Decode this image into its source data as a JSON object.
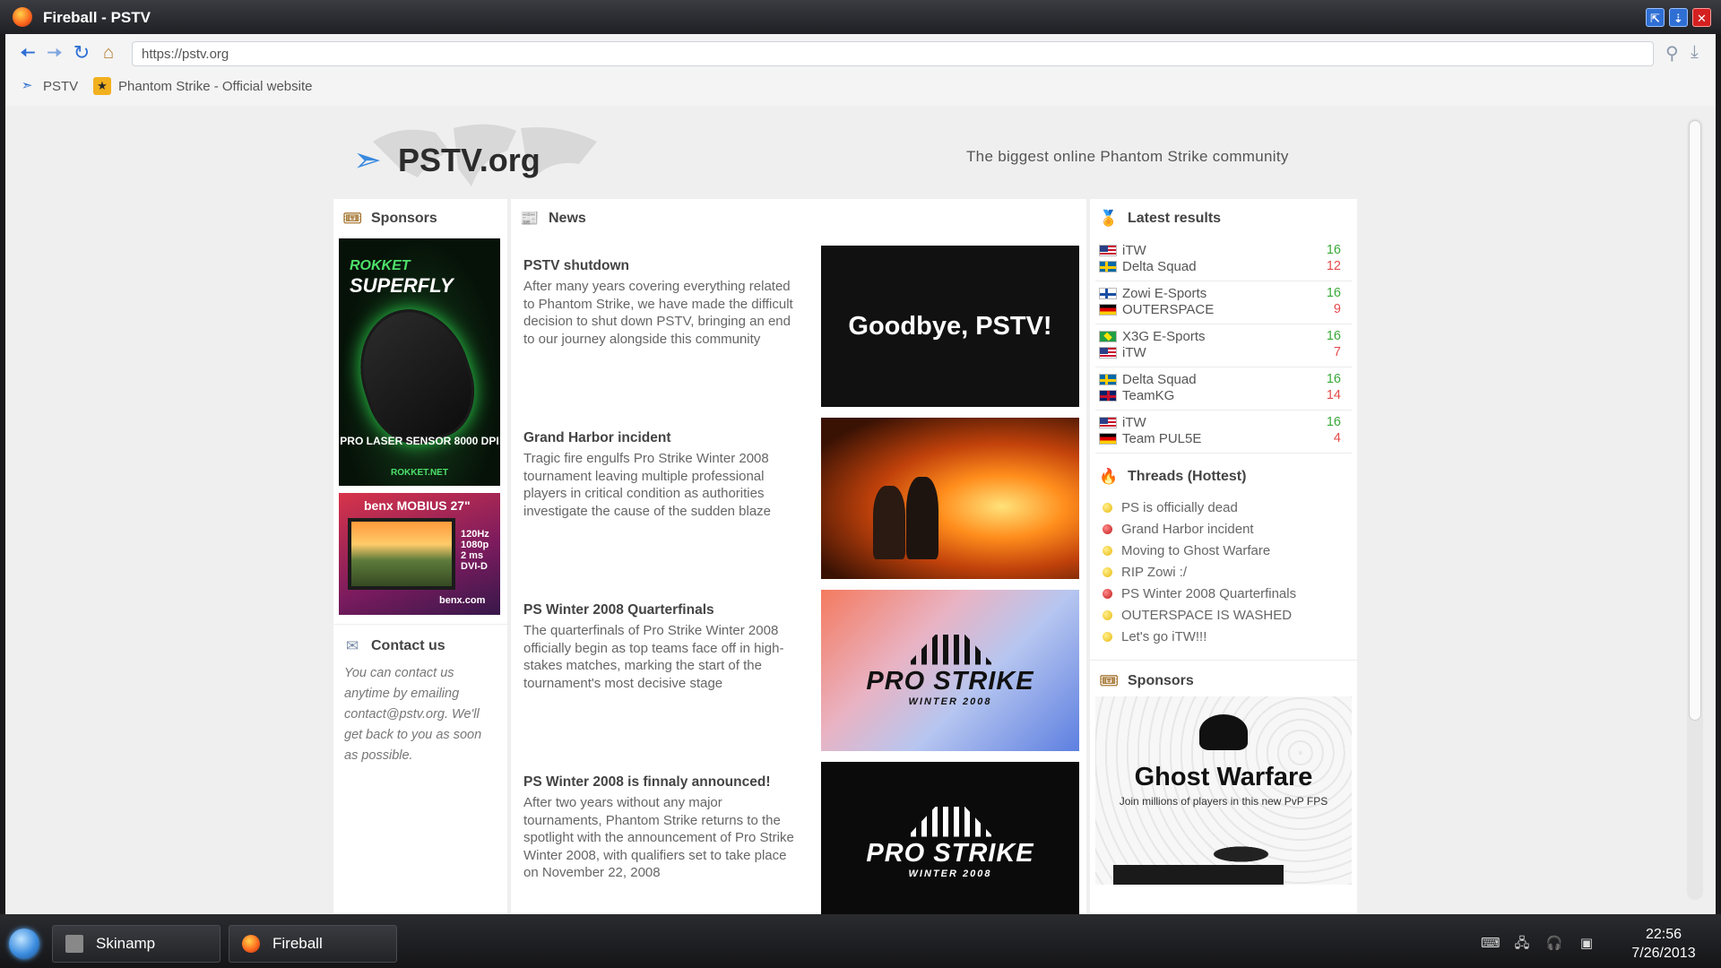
{
  "window": {
    "title": "Fireball - PSTV",
    "restore_symbol": "⇱",
    "minimize_symbol": "⇣",
    "close_symbol": "✕"
  },
  "browser": {
    "url": "https://pstv.org",
    "bookmarks": [
      {
        "label": "PSTV",
        "icon": "pstv-icon"
      },
      {
        "label": "Phantom Strike - Official website",
        "icon": "phantom-strike-icon"
      }
    ]
  },
  "site": {
    "logo_text": "PSTV.org",
    "tagline": "The biggest online Phantom Strike community"
  },
  "sponsors_left": {
    "heading": "Sponsors",
    "rokket": {
      "brand_small": "ROKKET",
      "brand_big": "SUPERFLY",
      "sensor": "PRO LASER SENSOR 8000 DPI",
      "url": "ROKKET.NET"
    },
    "benx": {
      "brand": "benx MOBIUS 27\"",
      "specs": [
        "120Hz",
        "1080p",
        "2 ms",
        "DVI-D"
      ],
      "url": "benx.com"
    }
  },
  "contact": {
    "heading": "Contact us",
    "text": "You can contact us anytime by emailing contact@pstv.org. We'll get back to you as soon as possible."
  },
  "news": {
    "heading": "News",
    "items": [
      {
        "title": "PSTV shutdown",
        "body": "After many years covering everything related to Phantom Strike, we have made the difficult decision to shut down PSTV, bringing an end to our journey alongside this community",
        "image_text": "Goodbye, PSTV!"
      },
      {
        "title": "Grand Harbor incident",
        "body": "Tragic fire engulfs Pro Strike Winter 2008 tournament leaving multiple professional players in critical condition as authorities investigate the cause of the sudden blaze"
      },
      {
        "title": "PS Winter 2008 Quarterfinals",
        "body": "The quarterfinals of Pro Strike Winter 2008 officially begin as top teams face off in high-stakes matches, marking the start of the tournament's most decisive stage",
        "image_logo": "PRO STRIKE",
        "image_sub": "WINTER 2008"
      },
      {
        "title": "PS Winter 2008 is finnaly announced!",
        "body": "After two years without any major tournaments, Phantom Strike returns to the spotlight with the announcement of Pro Strike Winter 2008, with qualifiers set to take place on November 22, 2008",
        "image_logo": "PRO STRIKE",
        "image_sub": "WINTER 2008"
      }
    ]
  },
  "results": {
    "heading": "Latest results",
    "matches": [
      {
        "team1": "iTW",
        "flag1": "us",
        "score1": "16",
        "team2": "Delta Squad",
        "flag2": "se",
        "score2": "12"
      },
      {
        "team1": "Zowi E-Sports",
        "flag1": "fi",
        "score1": "16",
        "team2": "OUTERSPACE",
        "flag2": "de",
        "score2": "9"
      },
      {
        "team1": "X3G E-Sports",
        "flag1": "br",
        "score1": "16",
        "team2": "iTW",
        "flag2": "us",
        "score2": "7"
      },
      {
        "team1": "Delta Squad",
        "flag1": "se",
        "score1": "16",
        "team2": "TeamKG",
        "flag2": "gb",
        "score2": "14"
      },
      {
        "team1": "iTW",
        "flag1": "us",
        "score1": "16",
        "team2": "Team PUL5E",
        "flag2": "de",
        "score2": "4"
      }
    ],
    "colors": {
      "win": "#3aa93a",
      "lose": "#e44b4b"
    }
  },
  "threads": {
    "heading": "Threads (Hottest)",
    "items": [
      {
        "label": "PS is officially dead",
        "status": "hot"
      },
      {
        "label": "Grand Harbor incident",
        "status": "red"
      },
      {
        "label": "Moving to Ghost Warfare",
        "status": "hot"
      },
      {
        "label": "RIP Zowi :/",
        "status": "hot"
      },
      {
        "label": "PS Winter 2008 Quarterfinals",
        "status": "red"
      },
      {
        "label": "OUTERSPACE IS WASHED",
        "status": "hot"
      },
      {
        "label": "Let's go iTW!!!",
        "status": "hot"
      }
    ]
  },
  "sponsors_right": {
    "heading": "Sponsors",
    "ghost_warfare": {
      "title": "Ghost Warfare",
      "subtitle": "Join millions of players in this new PvP FPS"
    }
  },
  "taskbar": {
    "tasks": [
      {
        "label": "Skinamp",
        "icon": "skinamp-icon"
      },
      {
        "label": "Fireball",
        "icon": "fireball-icon"
      }
    ],
    "time": "22:56",
    "date": "7/26/2013"
  }
}
